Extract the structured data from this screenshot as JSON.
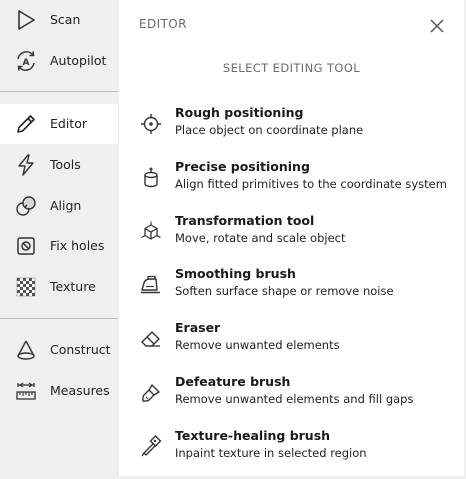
{
  "sidebar": {
    "items": [
      {
        "label": "Scan",
        "icon": "scan-icon"
      },
      {
        "label": "Autopilot",
        "icon": "autopilot-icon"
      },
      {
        "label": "Editor",
        "icon": "pencil-icon",
        "active": true
      },
      {
        "label": "Tools",
        "icon": "lightning-icon"
      },
      {
        "label": "Align",
        "icon": "align-icon"
      },
      {
        "label": "Fix holes",
        "icon": "fix-holes-icon"
      },
      {
        "label": "Texture",
        "icon": "texture-icon"
      },
      {
        "label": "Construct",
        "icon": "cone-icon"
      },
      {
        "label": "Measures",
        "icon": "ruler-icon"
      }
    ]
  },
  "panel": {
    "title": "EDITOR",
    "subtitle": "SELECT EDITING TOOL",
    "tools": [
      {
        "name": "Rough positioning",
        "description": "Place object on coordinate plane",
        "icon": "target-icon"
      },
      {
        "name": "Precise positioning",
        "description": "Align fitted primitives to the coordinate system",
        "icon": "cylinder-icon"
      },
      {
        "name": "Transformation tool",
        "description": "Move, rotate and scale object",
        "icon": "transform-cube-icon"
      },
      {
        "name": "Smoothing brush",
        "description": "Soften surface shape or remove noise",
        "icon": "iron-icon"
      },
      {
        "name": "Eraser",
        "description": "Remove unwanted elements",
        "icon": "eraser-icon"
      },
      {
        "name": "Defeature brush",
        "description": "Remove unwanted elements and fill gaps",
        "icon": "brush-icon"
      },
      {
        "name": "Texture-healing brush",
        "description": "Inpaint texture in selected region",
        "icon": "healing-brush-icon"
      }
    ]
  },
  "colors": {
    "sidebar_bg": "#efefef",
    "panel_bg": "#ffffff",
    "muted_text": "#6b6b6b"
  }
}
